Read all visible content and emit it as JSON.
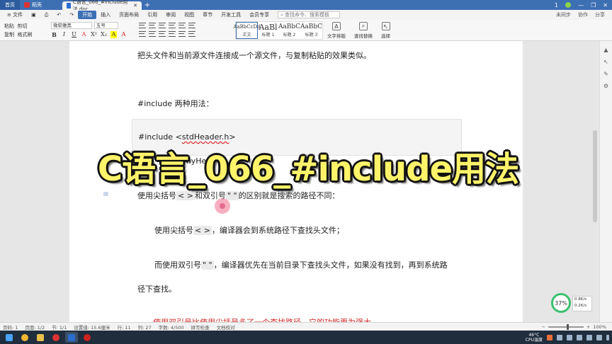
{
  "tabs": {
    "home": "首页",
    "wps": "稻壳",
    "doc": "C语言_066_#include用法.doc",
    "add": "+"
  },
  "window_controls": {
    "badge": "1"
  },
  "menu": {
    "file": "文件",
    "items": [
      "开始",
      "插入",
      "页面布局",
      "引用",
      "审阅",
      "视图",
      "章节",
      "开发工具",
      "会员专享"
    ],
    "search_placeholder": "查找命令、搜索模板",
    "right": [
      "未同步",
      "协作",
      "分享"
    ]
  },
  "ribbon": {
    "left_items": [
      "粘贴",
      "剪切",
      "复制",
      "格式刷"
    ],
    "font_name": "微软雅黑",
    "font_size": "五号",
    "format_buttons": [
      "B",
      "I",
      "U",
      "A",
      "X²",
      "X₂",
      "A",
      "A"
    ],
    "styles": [
      {
        "sample": "AaBbCcDd",
        "label": "正文"
      },
      {
        "sample": "AaBl",
        "label": "标题 1"
      },
      {
        "sample": "AaBbC",
        "label": "标题 2"
      },
      {
        "sample": "AaBbC",
        "label": "标题 3"
      }
    ],
    "tools": [
      "文字排版",
      "查找替换",
      "选择"
    ]
  },
  "document": {
    "line1": "把头文件和当前源文件连接成一个源文件，与复制粘贴的效果类似。",
    "heading": "#include  两种用法：",
    "code1_prefix": "#include <",
    "code1_word": "stdHeader.h",
    "code1_suffix": ">",
    "code2_fragment": "myHe",
    "line_compare_a": "使用尖括号",
    "line_compare_b": "< >",
    "line_compare_c": "和双引号",
    "line_compare_d": "\" \"",
    "line_compare_e": "的区别就是搜索的路径不同：",
    "line_angle_a": "使用尖括号",
    "line_angle_b": "< >",
    "line_angle_c": "，编译器会到系统路径下查找头文件；",
    "line_quote_a": "而使用双引号",
    "line_quote_b": "\" \"",
    "line_quote_c": "，编译器优先在当前目录下查找头文件，如果没有找到，再到系统路",
    "line_quote_cont": "径下查找。",
    "red_line": "使用双引号比使用尖括号多了一个查找路径，它的功能更为强大。"
  },
  "overlay": {
    "title": "C语言_066_#include用法"
  },
  "widget": {
    "percent": "37%",
    "up": "0.8K/s",
    "down": "0.2K/s"
  },
  "statusbar": {
    "items": [
      "页码: 1",
      "页面: 1/2",
      "节: 1/1",
      "设置值: 15.6厘米",
      "行: 11",
      "列: 27",
      "字数: 4/500",
      "拼写检查",
      "文档校对"
    ],
    "zoom": "100%"
  },
  "taskbar": {
    "temp": "46°C",
    "temp_label": "CPU温度",
    "time": "",
    "colors": {
      "accent": "#3d6fb3",
      "overlay_text": "#fff36a",
      "red_text": "#d12a2a"
    }
  }
}
